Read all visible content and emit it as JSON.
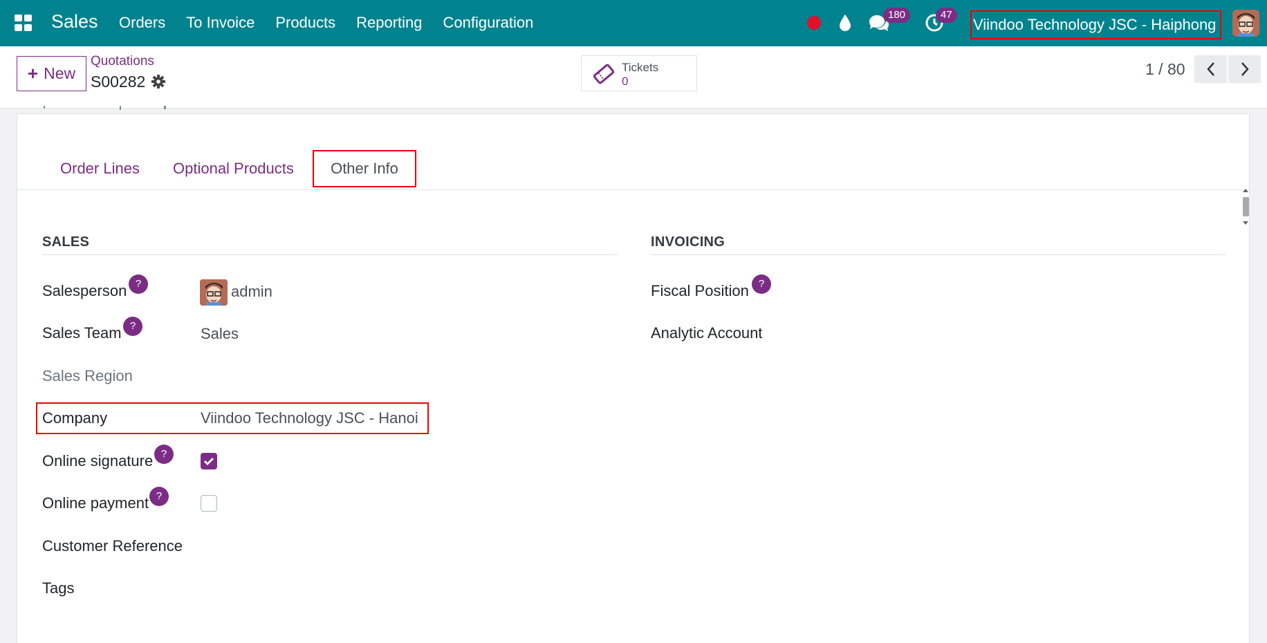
{
  "navbar": {
    "app_name": "Sales",
    "menu": [
      "Orders",
      "To Invoice",
      "Products",
      "Reporting",
      "Configuration"
    ],
    "messages_count": "180",
    "activities_count": "47",
    "company_switcher": "Viindoo Technology JSC - Haiphong",
    "colors": {
      "bar": "#00838f",
      "record_dot": "#e0112b",
      "badge": "#7b2d85"
    },
    "icons": [
      "apps-icon",
      "record-dot-icon",
      "drop-icon",
      "chat-icon",
      "clock-icon",
      "avatar"
    ]
  },
  "control_panel": {
    "new_button": "New",
    "breadcrumb": "Quotations",
    "record_name": "S00282",
    "tickets_label": "Tickets",
    "tickets_count": "0",
    "pager_value": "1 / 80"
  },
  "tabs": [
    "Order Lines",
    "Optional Products",
    "Other Info"
  ],
  "active_tab": "Other Info",
  "sales": {
    "title": "SALES",
    "salesperson_label": "Salesperson",
    "salesperson_value": "admin",
    "sales_team_label": "Sales Team",
    "sales_team_value": "Sales",
    "sales_region_label": "Sales Region",
    "company_label": "Company",
    "company_value": "Viindoo Technology JSC - Hanoi",
    "online_signature_label": "Online signature",
    "online_signature_checked": true,
    "online_payment_label": "Online payment",
    "online_payment_checked": false,
    "customer_reference_label": "Customer Reference",
    "tags_label": "Tags",
    "help_mark": "?"
  },
  "invoicing": {
    "title": "INVOICING",
    "fiscal_position_label": "Fiscal Position",
    "analytic_account_label": "Analytic Account"
  },
  "accent_color": "#7b2d85",
  "highlight_color": "#e00000"
}
